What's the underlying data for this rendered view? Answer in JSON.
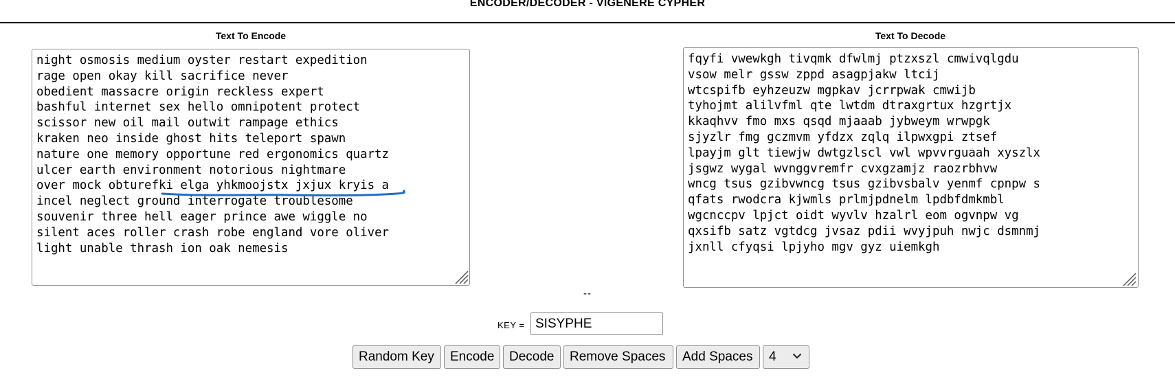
{
  "page": {
    "title": "ENCODER/DECODER - VIGENERE CYPHER",
    "separator": "--"
  },
  "encode_panel": {
    "label": "Text To Encode",
    "text": "night osmosis medium oyster restart expedition\nrage open okay kill sacrifice never\nobedient massacre origin reckless expert\nbashful internet sex hello omnipotent protect\nscissor new oil mail outwit rampage ethics\nkraken neo inside ghost hits teleport spawn\nnature one memory opportune red ergonomics quartz\nulcer earth environment notorious nightmare\nover mock obturefki elga yhkmoojstx jxjux kryis a\nincel neglect ground interrogate troublesome\nsouvenir three hell eager prince awe wiggle no\nsilent aces roller crash robe england vore oliver\nlight unable thrash ion oak nemesis"
  },
  "decode_panel": {
    "label": "Text To Decode",
    "text": "fqyfi vwewkgh tivqmk dfwlmj ptzxszl cmwivqlgdu\nvsow melr gssw zppd asagpjakw ltcij\nwtcspifb eyhzeuzw mgpkav jcrrpwak cmwijb\ntyhojmt alilvfml qte lwtdm dtraxgrtux hzgrtjx\nkkaqhvv fmo mxs qsqd mjaaab jybweym wrwpgk\nsjyzlr fmg gczmvm yfdzx zqlq ilpwxgpi ztsef\nlpayjm glt tiewjw dwtgzlscl vwl wpvvrguaah xyszlx\njsgwz wygal wvnggvremfr cvxgzamjz raozrbhvw\nwncg tsus gzibvwncg tsus gzibvsbalv yenmf cpnpw s\nqfats rwodcra kjwmls prlmjpdnelm lpdbfdmkmbl\nwgcnccpv lpjct oidt wyvlv hzalrl eom ogvnpw vg\nqxsifb satz vgtdcg jvsaz pdii wvyjpuh nwjc dsmnmj\njxnll cfyqsi lpjyho mgv gyz uiemkgh"
  },
  "key": {
    "label": "KEY =",
    "value": "SISYPHE"
  },
  "toolbar": {
    "random_key_label": "Random Key",
    "encode_label": "Encode",
    "decode_label": "Decode",
    "remove_spaces_label": "Remove Spaces",
    "add_spaces_label": "Add Spaces",
    "group_size_value": "4"
  },
  "icons": {
    "resize_grip": "resize-grip-icon",
    "dropdown": "chevron-down-icon"
  },
  "colors": {
    "annotation_ink": "#1f6fc4",
    "spellcheck": "#e02020"
  }
}
